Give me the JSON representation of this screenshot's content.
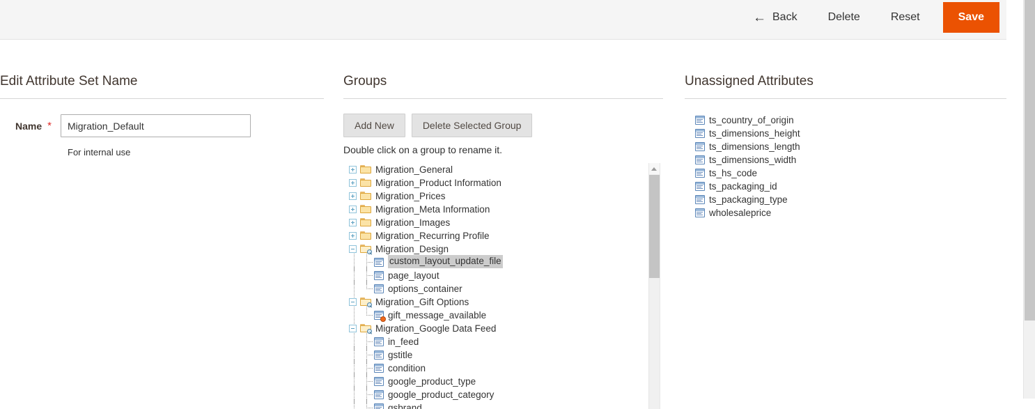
{
  "header": {
    "back_label": "Back",
    "delete_label": "Delete",
    "reset_label": "Reset",
    "save_label": "Save",
    "save_color": "#eb5202"
  },
  "left_panel": {
    "title": "Edit Attribute Set Name",
    "name_label": "Name",
    "required_marker": "*",
    "name_value": "Migration_Default",
    "name_placeholder": "",
    "name_note": "For internal use"
  },
  "groups_panel": {
    "title": "Groups",
    "add_new_label": "Add New",
    "delete_group_label": "Delete Selected Group",
    "hint": "Double click on a group to rename it.",
    "tree": [
      {
        "label": "Migration_General",
        "type": "folder",
        "state": "collapsed",
        "depth": 0
      },
      {
        "label": "Migration_Product Information",
        "type": "folder",
        "state": "collapsed",
        "depth": 0
      },
      {
        "label": "Migration_Prices",
        "type": "folder",
        "state": "collapsed",
        "depth": 0
      },
      {
        "label": "Migration_Meta Information",
        "type": "folder",
        "state": "collapsed",
        "depth": 0
      },
      {
        "label": "Migration_Images",
        "type": "folder",
        "state": "collapsed",
        "depth": 0
      },
      {
        "label": "Migration_Recurring Profile",
        "type": "folder",
        "state": "collapsed",
        "depth": 0
      },
      {
        "label": "Migration_Design",
        "type": "folder",
        "state": "expanded",
        "depth": 0
      },
      {
        "label": "custom_layout_update_file",
        "type": "attribute",
        "depth": 1,
        "selected": true
      },
      {
        "label": "page_layout",
        "type": "attribute",
        "depth": 1
      },
      {
        "label": "options_container",
        "type": "attribute",
        "depth": 1
      },
      {
        "label": "Migration_Gift Options",
        "type": "folder",
        "state": "expanded",
        "depth": 0
      },
      {
        "label": "gift_message_available",
        "type": "attribute",
        "depth": 1,
        "badge": true
      },
      {
        "label": "Migration_Google Data Feed",
        "type": "folder",
        "state": "expanded",
        "depth": 0
      },
      {
        "label": "in_feed",
        "type": "attribute",
        "depth": 1
      },
      {
        "label": "gstitle",
        "type": "attribute",
        "depth": 1
      },
      {
        "label": "condition",
        "type": "attribute",
        "depth": 1
      },
      {
        "label": "google_product_type",
        "type": "attribute",
        "depth": 1
      },
      {
        "label": "google_product_category",
        "type": "attribute",
        "depth": 1
      },
      {
        "label": "gsbrand",
        "type": "attribute",
        "depth": 1
      }
    ]
  },
  "unassigned_panel": {
    "title": "Unassigned Attributes",
    "attributes": [
      {
        "label": "ts_country_of_origin"
      },
      {
        "label": "ts_dimensions_height"
      },
      {
        "label": "ts_dimensions_length"
      },
      {
        "label": "ts_dimensions_width"
      },
      {
        "label": "ts_hs_code"
      },
      {
        "label": "ts_packaging_id"
      },
      {
        "label": "ts_packaging_type"
      },
      {
        "label": "wholesaleprice"
      }
    ]
  }
}
